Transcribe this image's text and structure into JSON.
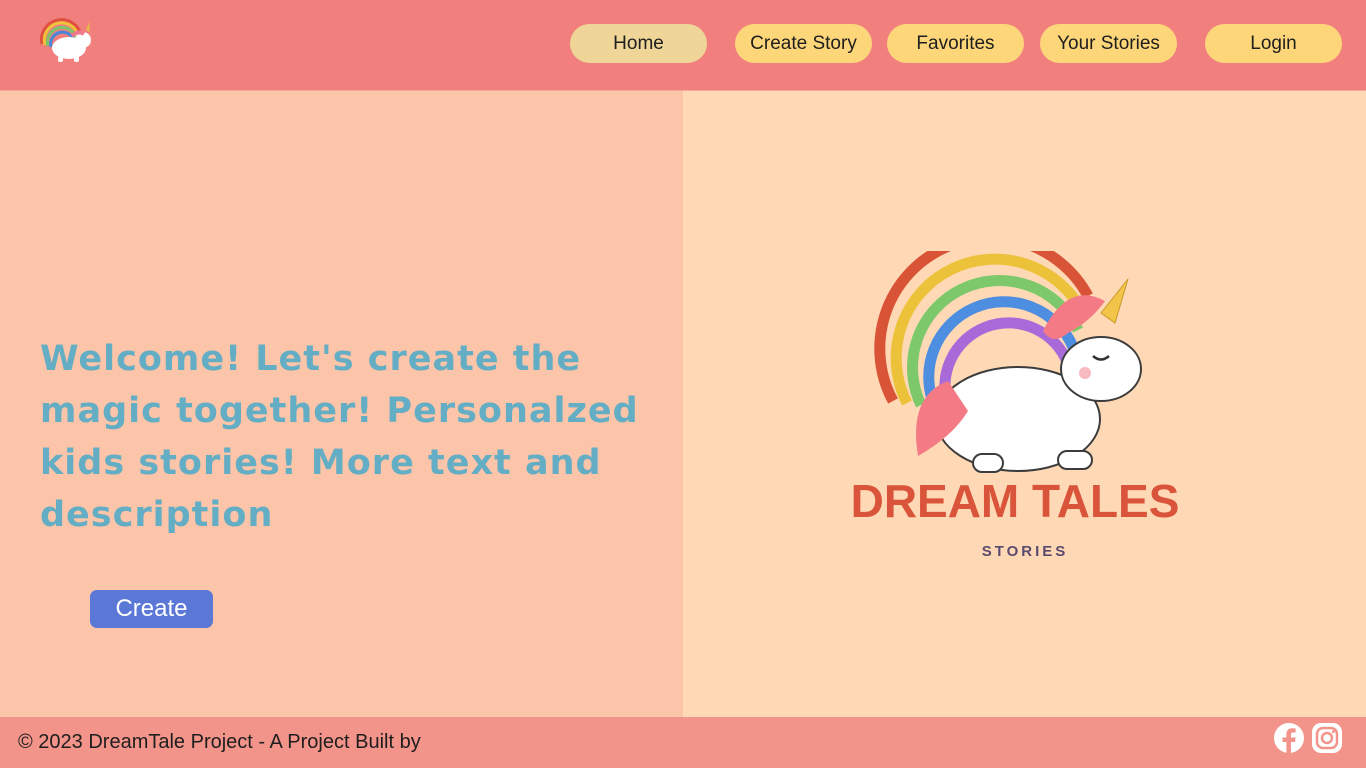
{
  "header": {
    "logo_icon": "unicorn-rainbow-logo-icon",
    "nav": [
      {
        "label": "Home",
        "active": true
      },
      {
        "label": "Create Story"
      },
      {
        "label": "Favorites"
      },
      {
        "label": "Your Stories"
      }
    ],
    "login_label": "Login"
  },
  "main": {
    "welcome_text": "Welcome! Let's create the magic together! Personalzed kids stories! More text and description",
    "create_label": "Create",
    "brand": {
      "name": "DREAM TALES",
      "tagline": "STORIES",
      "icon": "unicorn-rainbow-illustration"
    }
  },
  "footer": {
    "copyright": "© 2023 DreamTale Project - A Project Built by",
    "social": [
      "facebook-icon",
      "instagram-icon"
    ]
  },
  "colors": {
    "header_bg": "#f07f7e",
    "button_bg": "#fed67a",
    "left_bg": "#fcc4a9",
    "right_bg": "#ffd9b5",
    "heading": "#63aec4",
    "create_btn": "#5b78d6",
    "footer_bg": "#f3948b"
  }
}
